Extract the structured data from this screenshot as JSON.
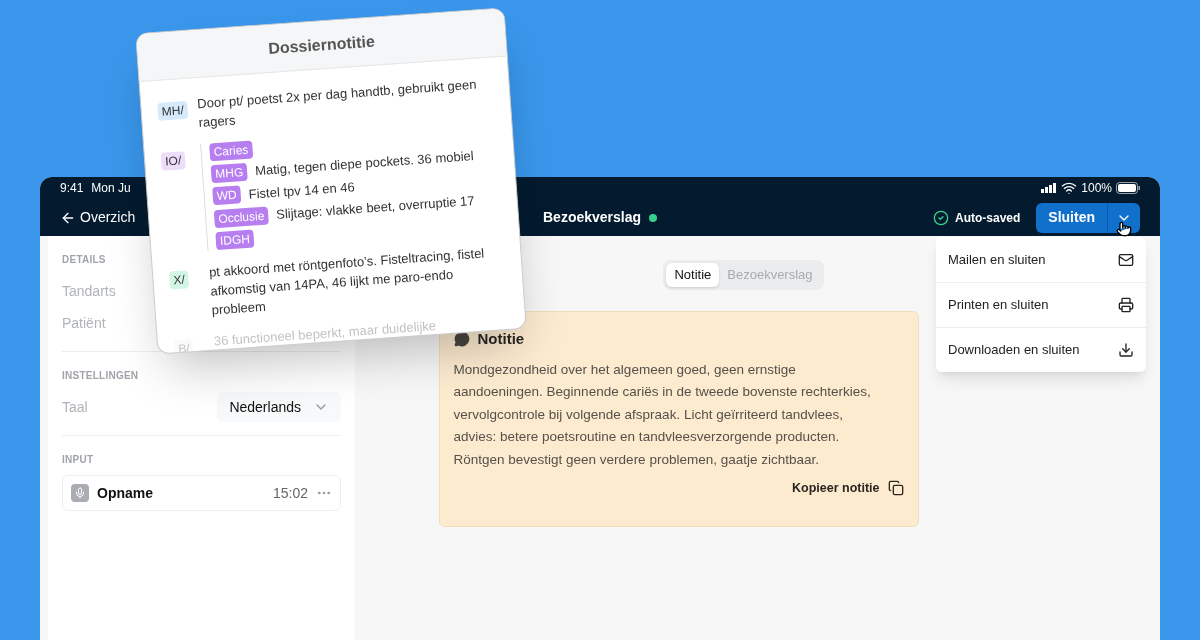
{
  "status_bar": {
    "time": "9:41",
    "date": "Mon Ju",
    "battery": "100%"
  },
  "nav": {
    "back": "Overzich",
    "title": "Bezoekverslag",
    "saved": "Auto-saved",
    "close_button": "Sluiten"
  },
  "sidebar": {
    "sections": [
      {
        "heading": "DETAILS",
        "rows": [
          {
            "label": "Tandarts"
          },
          {
            "label": "Patiënt"
          }
        ]
      },
      {
        "heading": "INSTELLINGEN",
        "rows": [
          {
            "label": "Taal",
            "value": "Nederlands"
          }
        ]
      },
      {
        "heading": "INPUT",
        "recording": {
          "name": "Opname",
          "duration": "15:02"
        }
      }
    ]
  },
  "tabs": [
    {
      "label": "Notitie",
      "selected": true
    },
    {
      "label": "Bezoekverslag",
      "selected": false
    }
  ],
  "note": {
    "title": "Notitie",
    "text": "Mondgezondheid over het algemeen goed, geen ernstige aandoeningen. Beginnende cariës in de tweede bovenste rechterkies, vervolgcontrole bij volgende afspraak. Licht geïrriteerd tandvlees, advies: betere poetsroutine en tandvleesverzorgende producten. Röntgen bevestigt geen verdere problemen, gaatje zichtbaar.",
    "copy": "Kopieer notitie"
  },
  "menu": [
    {
      "label": "Mailen en sluiten",
      "kind": "mail"
    },
    {
      "label": "Printen en sluiten",
      "kind": "print"
    },
    {
      "label": "Downloaden en sluiten",
      "kind": "download"
    }
  ],
  "dossier": {
    "title": "Dossiernotitie",
    "sections": [
      {
        "tag": "MH/",
        "color": "#d6eafc",
        "text": "Door pt/ poetst 2x per dag handtb, gebruikt geen ragers",
        "faded": false
      },
      {
        "tag": "IO/",
        "color": "#eedcfb",
        "faded": false,
        "items": [
          {
            "tag": "Caries"
          },
          {
            "tag": "MHG",
            "text": "Matig, tegen diepe pockets. 36 mobiel"
          },
          {
            "tag": "WD",
            "text": "Fistel tpv 14 en 46"
          },
          {
            "tag": "Occlusie",
            "text": "Slijtage: vlakke beet, overruptie 17"
          },
          {
            "tag": "IDGH"
          }
        ]
      },
      {
        "tag": "X/",
        "color": "#d3f5e4",
        "text": "pt akkoord met röntgenfoto’s. Fisteltracing, fistel afkomstig van 14PA, 46 lijkt me paro-endo probleem",
        "faded": false
      },
      {
        "tag": "B/",
        "color": "#eeeeee",
        "text": "36 functioneel beperkt, maar duidelijke",
        "faded": true
      }
    ]
  }
}
